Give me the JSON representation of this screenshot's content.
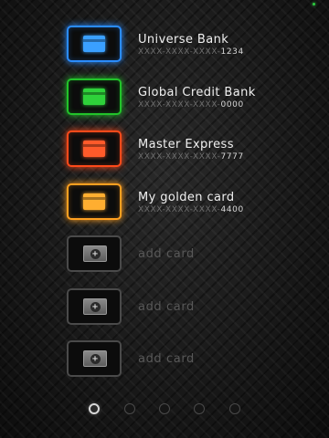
{
  "cards": [
    {
      "name": "Universe Bank",
      "number_mask": "XXXX-XXXX-XXXX-",
      "last4": "1234",
      "color": "#2a8cff",
      "fill": "#3aa0ff"
    },
    {
      "name": "Global Credit Bank",
      "number_mask": "XXXX-XXXX-XXXX-",
      "last4": "0000",
      "color": "#22c32a",
      "fill": "#2ed13a"
    },
    {
      "name": "Master Express",
      "number_mask": "XXXX-XXXX-XXXX-",
      "last4": "7777",
      "color": "#ff4a1a",
      "fill": "#ff5a2a"
    },
    {
      "name": "My golden card",
      "number_mask": "XXXX-XXXX-XXXX-",
      "last4": "4400",
      "color": "#ffa020",
      "fill": "#ffae30"
    }
  ],
  "empty_slots": [
    {
      "label": "add card",
      "icon": "add-card-icon"
    },
    {
      "label": "add card",
      "icon": "add-card-icon"
    },
    {
      "label": "add card",
      "icon": "add-card-icon"
    }
  ],
  "pager": {
    "pages": 5,
    "active_index": 0
  },
  "colors": {
    "status_dot": "#2ecc40",
    "empty_border": "#4a4a4a"
  }
}
